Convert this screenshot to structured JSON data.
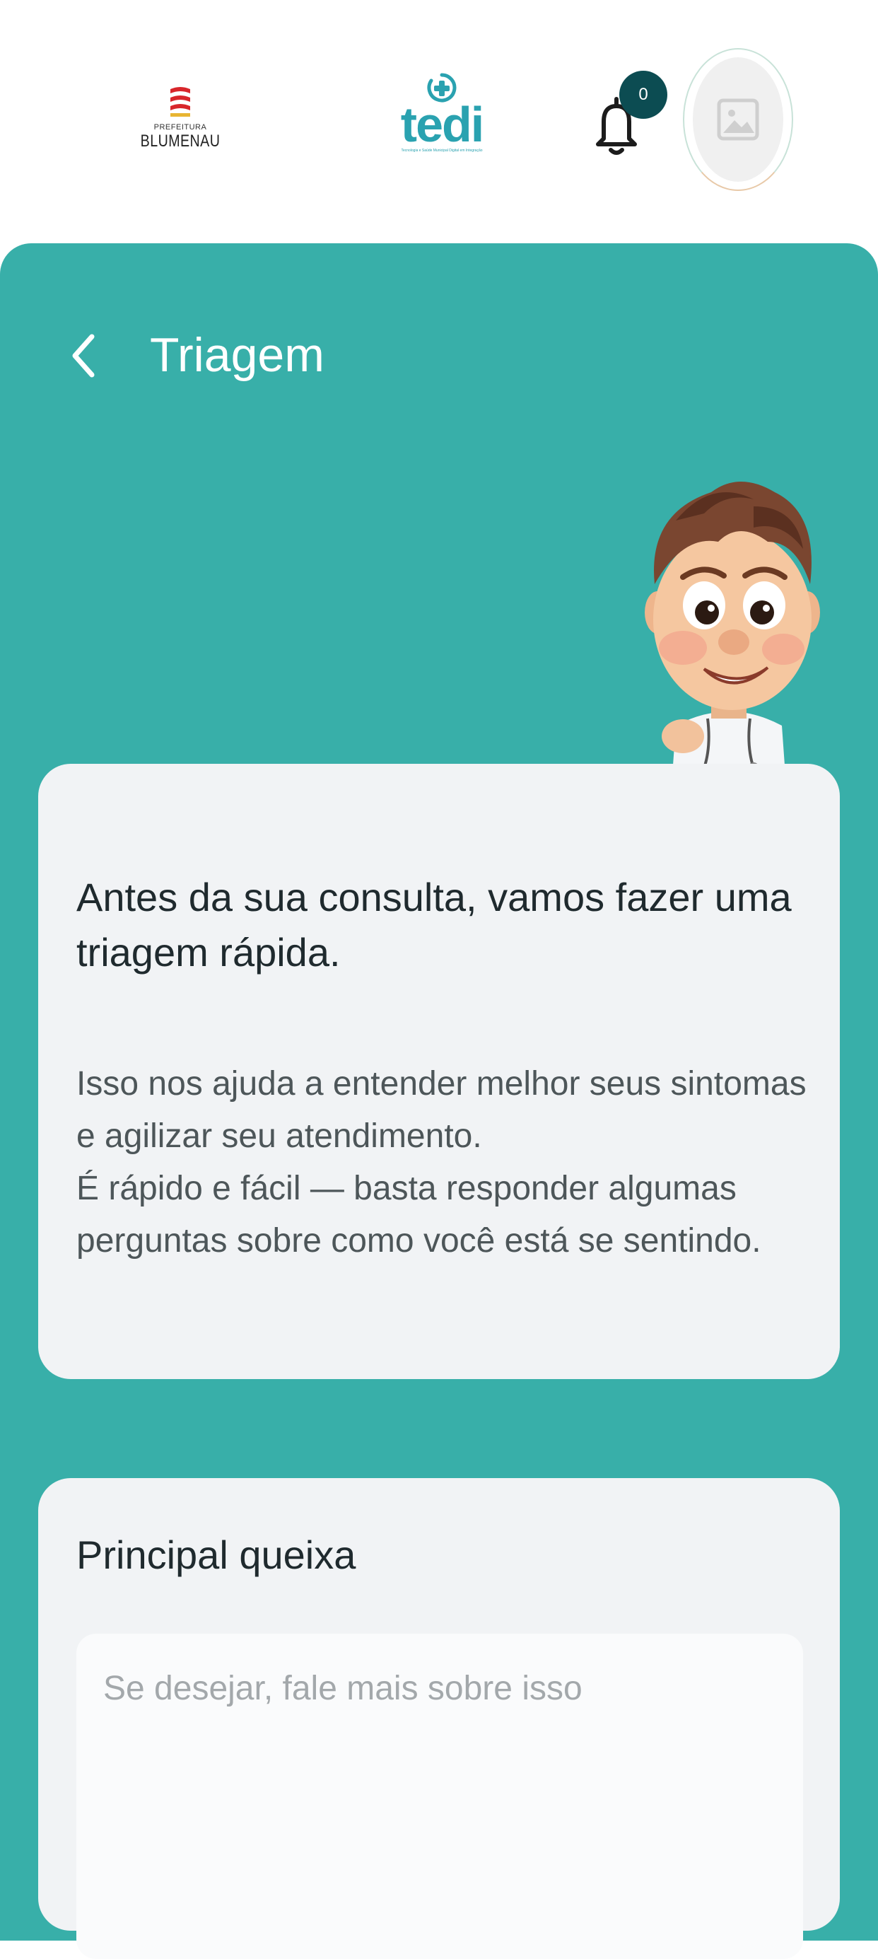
{
  "header": {
    "prefeitura_small": "PREFEITURA",
    "prefeitura_big": "BLUMENAU",
    "app_name": "tedi",
    "app_tagline": "Tecnologia e Saúde Municipal Digital em Integração",
    "notification_count": "0"
  },
  "page": {
    "title": "Triagem"
  },
  "intro_card": {
    "heading": "Antes da sua consulta, vamos fazer uma triagem rápida.",
    "body_line1": "Isso nos ajuda a entender melhor seus sintomas e agilizar seu atendimento.",
    "body_line2": "É rápido e fácil — basta responder algumas perguntas sobre como você está se sentindo."
  },
  "complaint_card": {
    "label": "Principal queixa",
    "placeholder": "Se desejar, fale mais sobre isso"
  },
  "icons": {
    "back": "chevron-left-icon",
    "bell": "bell-icon",
    "avatar": "image-placeholder-icon"
  },
  "colors": {
    "panel": "#38afa9",
    "card": "#f1f3f5",
    "brand": "#2aa2b0",
    "badge": "#0c4c52"
  }
}
